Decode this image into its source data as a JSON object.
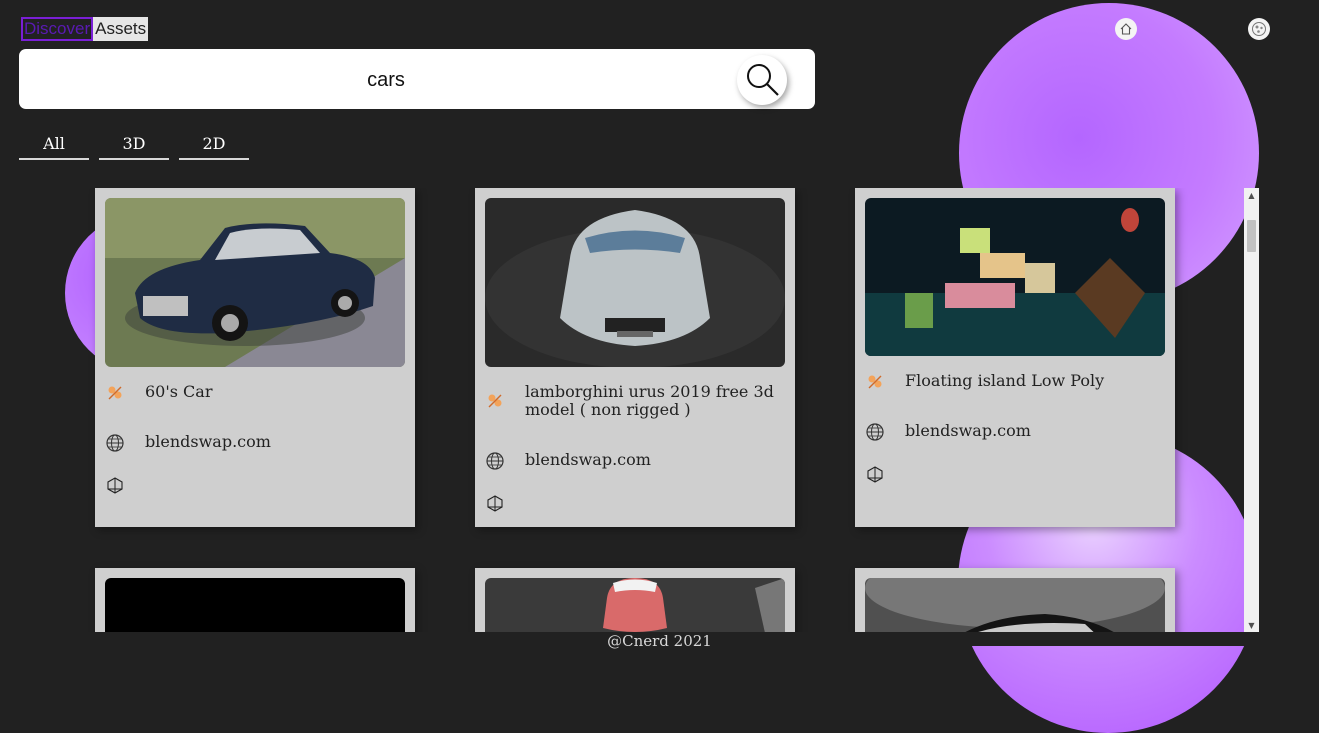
{
  "logo": {
    "part1": "Discover",
    "part2": "Assets"
  },
  "nav": {
    "home_icon": "home-icon",
    "profile_icon": "profile-icon"
  },
  "search": {
    "value": "cars",
    "icon": "search-icon"
  },
  "tabs": [
    {
      "label": "All"
    },
    {
      "label": "3D"
    },
    {
      "label": "2D"
    }
  ],
  "results": [
    {
      "title": "60's Car",
      "source": "blendswap.com",
      "type_icon": "film-reel-icon",
      "source_icon": "globe-icon",
      "model_icon": "3d-model-icon"
    },
    {
      "title": "lamborghini urus 2019 free 3d model ( non rigged )",
      "source": "blendswap.com",
      "type_icon": "film-reel-icon",
      "source_icon": "globe-icon",
      "model_icon": "3d-model-icon"
    },
    {
      "title": "Floating island Low Poly",
      "source": "blendswap.com",
      "type_icon": "film-reel-icon",
      "source_icon": "globe-icon",
      "model_icon": "3d-model-icon"
    }
  ],
  "footer": {
    "text": "@Cnerd 2021"
  },
  "colors": {
    "accent_purple": "#b466ff",
    "background": "#212121",
    "card": "#cfcfcf"
  }
}
